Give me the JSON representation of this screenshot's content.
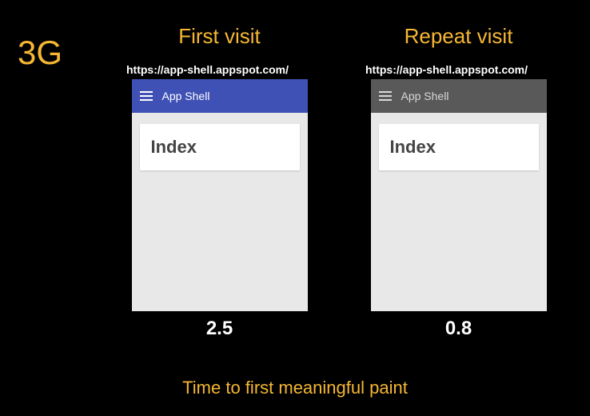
{
  "network_label": "3G",
  "caption": "Time to first meaningful paint",
  "columns": [
    {
      "title": "First visit",
      "url": "https://app-shell.appspot.com/",
      "appbar_style": "blue",
      "appbar_title": "App Shell",
      "card_title": "Index",
      "timing": "2.5"
    },
    {
      "title": "Repeat visit",
      "url": "https://app-shell.appspot.com/",
      "appbar_style": "grey",
      "appbar_title": "App Shell",
      "card_title": "Index",
      "timing": "0.8"
    }
  ]
}
